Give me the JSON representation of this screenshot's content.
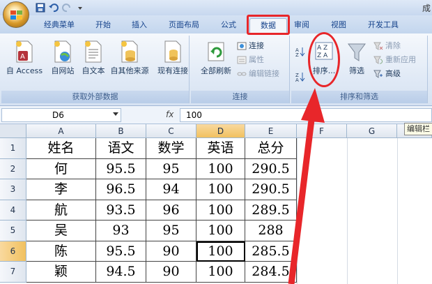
{
  "window": {
    "title": "成"
  },
  "tabs": [
    {
      "label": "经典菜单"
    },
    {
      "label": "开始"
    },
    {
      "label": "插入"
    },
    {
      "label": "页面布局"
    },
    {
      "label": "公式"
    },
    {
      "label": "数据"
    },
    {
      "label": "审阅"
    },
    {
      "label": "视图"
    },
    {
      "label": "开发工具"
    }
  ],
  "ribbon": {
    "external": {
      "label": "获取外部数据",
      "access": "自 Access",
      "web": "自网站",
      "text": "自文本",
      "other": "自其他来源",
      "existing": "现有连接"
    },
    "connections": {
      "label": "连接",
      "refresh": "全部刷新",
      "connect": "连接",
      "props": "属性",
      "editlinks": "编辑链接"
    },
    "sortfilter": {
      "label": "排序和筛选",
      "az": "A↓",
      "za": "Z↓",
      "sort": "排序...",
      "filter": "筛选",
      "clear": "清除",
      "reapply": "重新应用",
      "advanced": "高级"
    }
  },
  "formula": {
    "namebox": "D6",
    "fx": "fx",
    "value": "100",
    "tooltip": "编辑栏"
  },
  "sheet": {
    "columns": [
      "A",
      "B",
      "C",
      "D",
      "E",
      "F",
      "G"
    ],
    "rows": [
      [
        "1",
        "姓名",
        "语文",
        "数学",
        "英语",
        "总分"
      ],
      [
        "2",
        "何",
        "95.5",
        "95",
        "100",
        "290.5"
      ],
      [
        "3",
        "李",
        "96.5",
        "94",
        "100",
        "290.5"
      ],
      [
        "4",
        "航",
        "93.5",
        "96",
        "100",
        "289.5"
      ],
      [
        "5",
        "吴",
        "93",
        "95",
        "100",
        "288"
      ],
      [
        "6",
        "陈",
        "95.5",
        "90",
        "100",
        "285.5"
      ],
      [
        "7",
        "颖",
        "94.5",
        "90",
        "100",
        "284.5"
      ]
    ]
  },
  "colors": {
    "accent": "#e8262a",
    "selected_header": "#f1c15f"
  }
}
